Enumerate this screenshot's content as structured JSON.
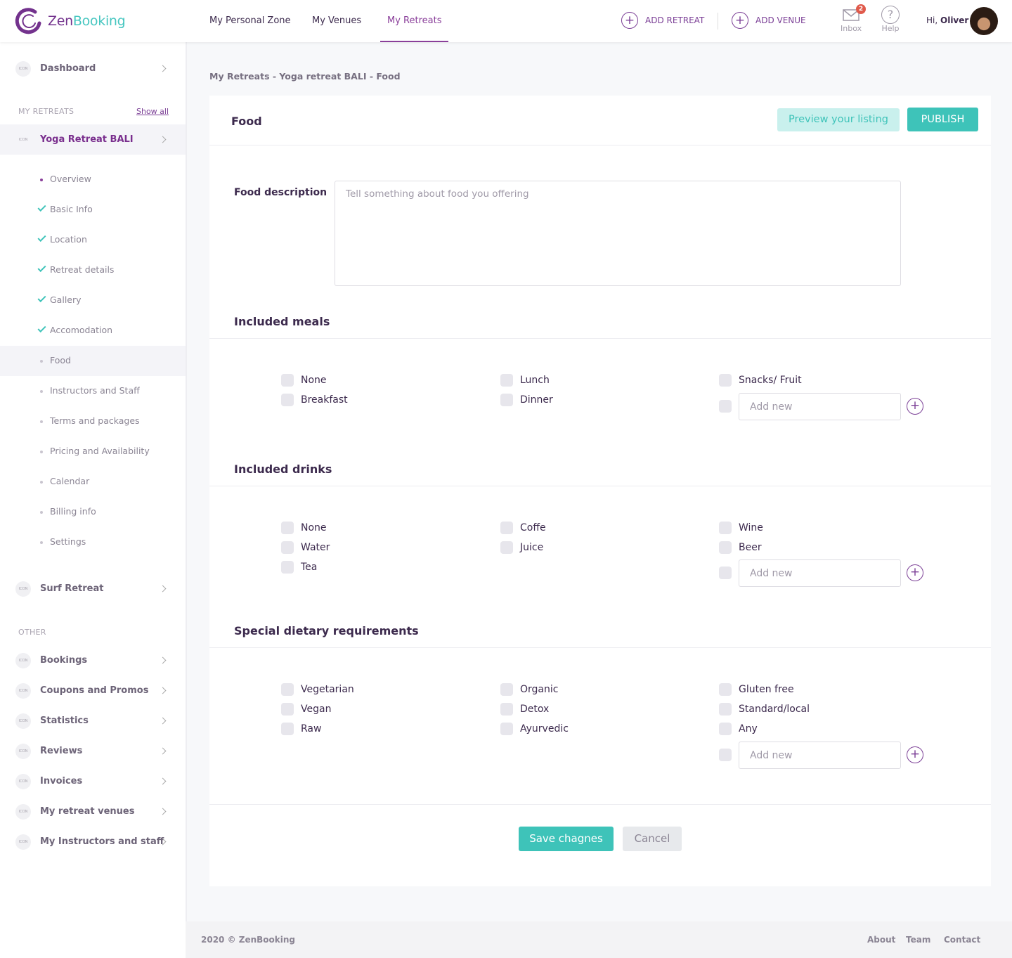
{
  "brand": {
    "part1": "Zen",
    "part2": "Booking",
    "accent": "#73328d",
    "teal": "#3ec3b9"
  },
  "nav": {
    "items": [
      "My Personal Zone",
      "My Venues",
      "My Retreats"
    ],
    "active": "My Retreats"
  },
  "actions": {
    "add_retreat": "ADD RETREAT",
    "add_venue": "ADD VENUE"
  },
  "inbox": {
    "label": "Inbox",
    "count": "2"
  },
  "help": {
    "label": "Help"
  },
  "user": {
    "greeting": "Hi,",
    "name": "Oliver"
  },
  "sidebar": {
    "dashboard": "Dashboard",
    "my_retreats_label": "MY RETREATS",
    "show_all": "Show all",
    "retreat_active": "Yoga Retreat BALI",
    "icon_text": "ICON",
    "subitems": [
      "Overview",
      "Basic Info",
      "Location",
      "Retreat details",
      "Gallery",
      "Accomodation",
      "Food",
      "Instructors and Staff",
      "Terms and packages",
      "Pricing and Availability",
      "Calendar",
      "Billing info",
      "Settings"
    ],
    "retreat_other": "Surf Retreat",
    "other_label": "OTHER",
    "other_items": [
      "Bookings",
      "Coupons and Promos",
      "Statistics",
      "Reviews",
      "Invoices",
      "My retreat venues",
      "My Instructors and staff"
    ]
  },
  "breadcrumb": "My Retreats - Yoga retreat BALI - Food",
  "card": {
    "title": "Food",
    "preview": "Preview your listing",
    "publish": "PUBLISH",
    "food_description_label": "Food description",
    "food_description_placeholder": "Tell something about food you offering",
    "add_new_placeholder": "Add new",
    "meals": {
      "title": "Included meals",
      "col1": [
        "None",
        "Breakfast"
      ],
      "col2": [
        "Lunch",
        "Dinner"
      ],
      "col3": [
        "Snacks/ Fruit"
      ]
    },
    "drinks": {
      "title": "Included drinks",
      "col1": [
        "None",
        "Water",
        "Tea"
      ],
      "col2": [
        "Coffe",
        "Juice"
      ],
      "col3": [
        "Wine",
        "Beer"
      ]
    },
    "dietary": {
      "title": "Special dietary requirements",
      "col1": [
        "Vegetarian",
        "Vegan",
        "Raw"
      ],
      "col2": [
        "Organic",
        "Detox",
        "Ayurvedic"
      ],
      "col3": [
        "Gluten free",
        "Standard/local",
        "Any"
      ]
    },
    "save": "Save chagnes",
    "cancel": "Cancel"
  },
  "footer": {
    "copy": "2020 © ZenBooking",
    "links": [
      "About",
      "Team",
      "Contact"
    ]
  }
}
